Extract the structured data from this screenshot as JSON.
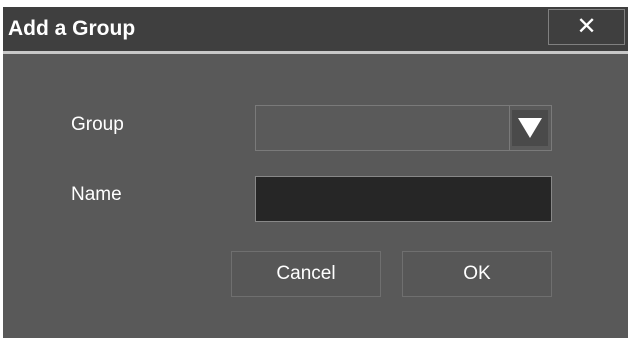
{
  "dialog": {
    "title": "Add a Group",
    "close_glyph": "✕",
    "close_icon": "close-icon"
  },
  "form": {
    "group_label": "Group",
    "group_value": "",
    "group_dropdown_icon": "triangle-down-icon",
    "name_label": "Name",
    "name_value": "",
    "name_placeholder": ""
  },
  "buttons": {
    "cancel_label": "Cancel",
    "ok_label": "OK"
  },
  "colors": {
    "dialog_background": "#595959",
    "titlebar_background": "#3f3f3f",
    "input_background": "#262626",
    "text": "#ffffff"
  }
}
